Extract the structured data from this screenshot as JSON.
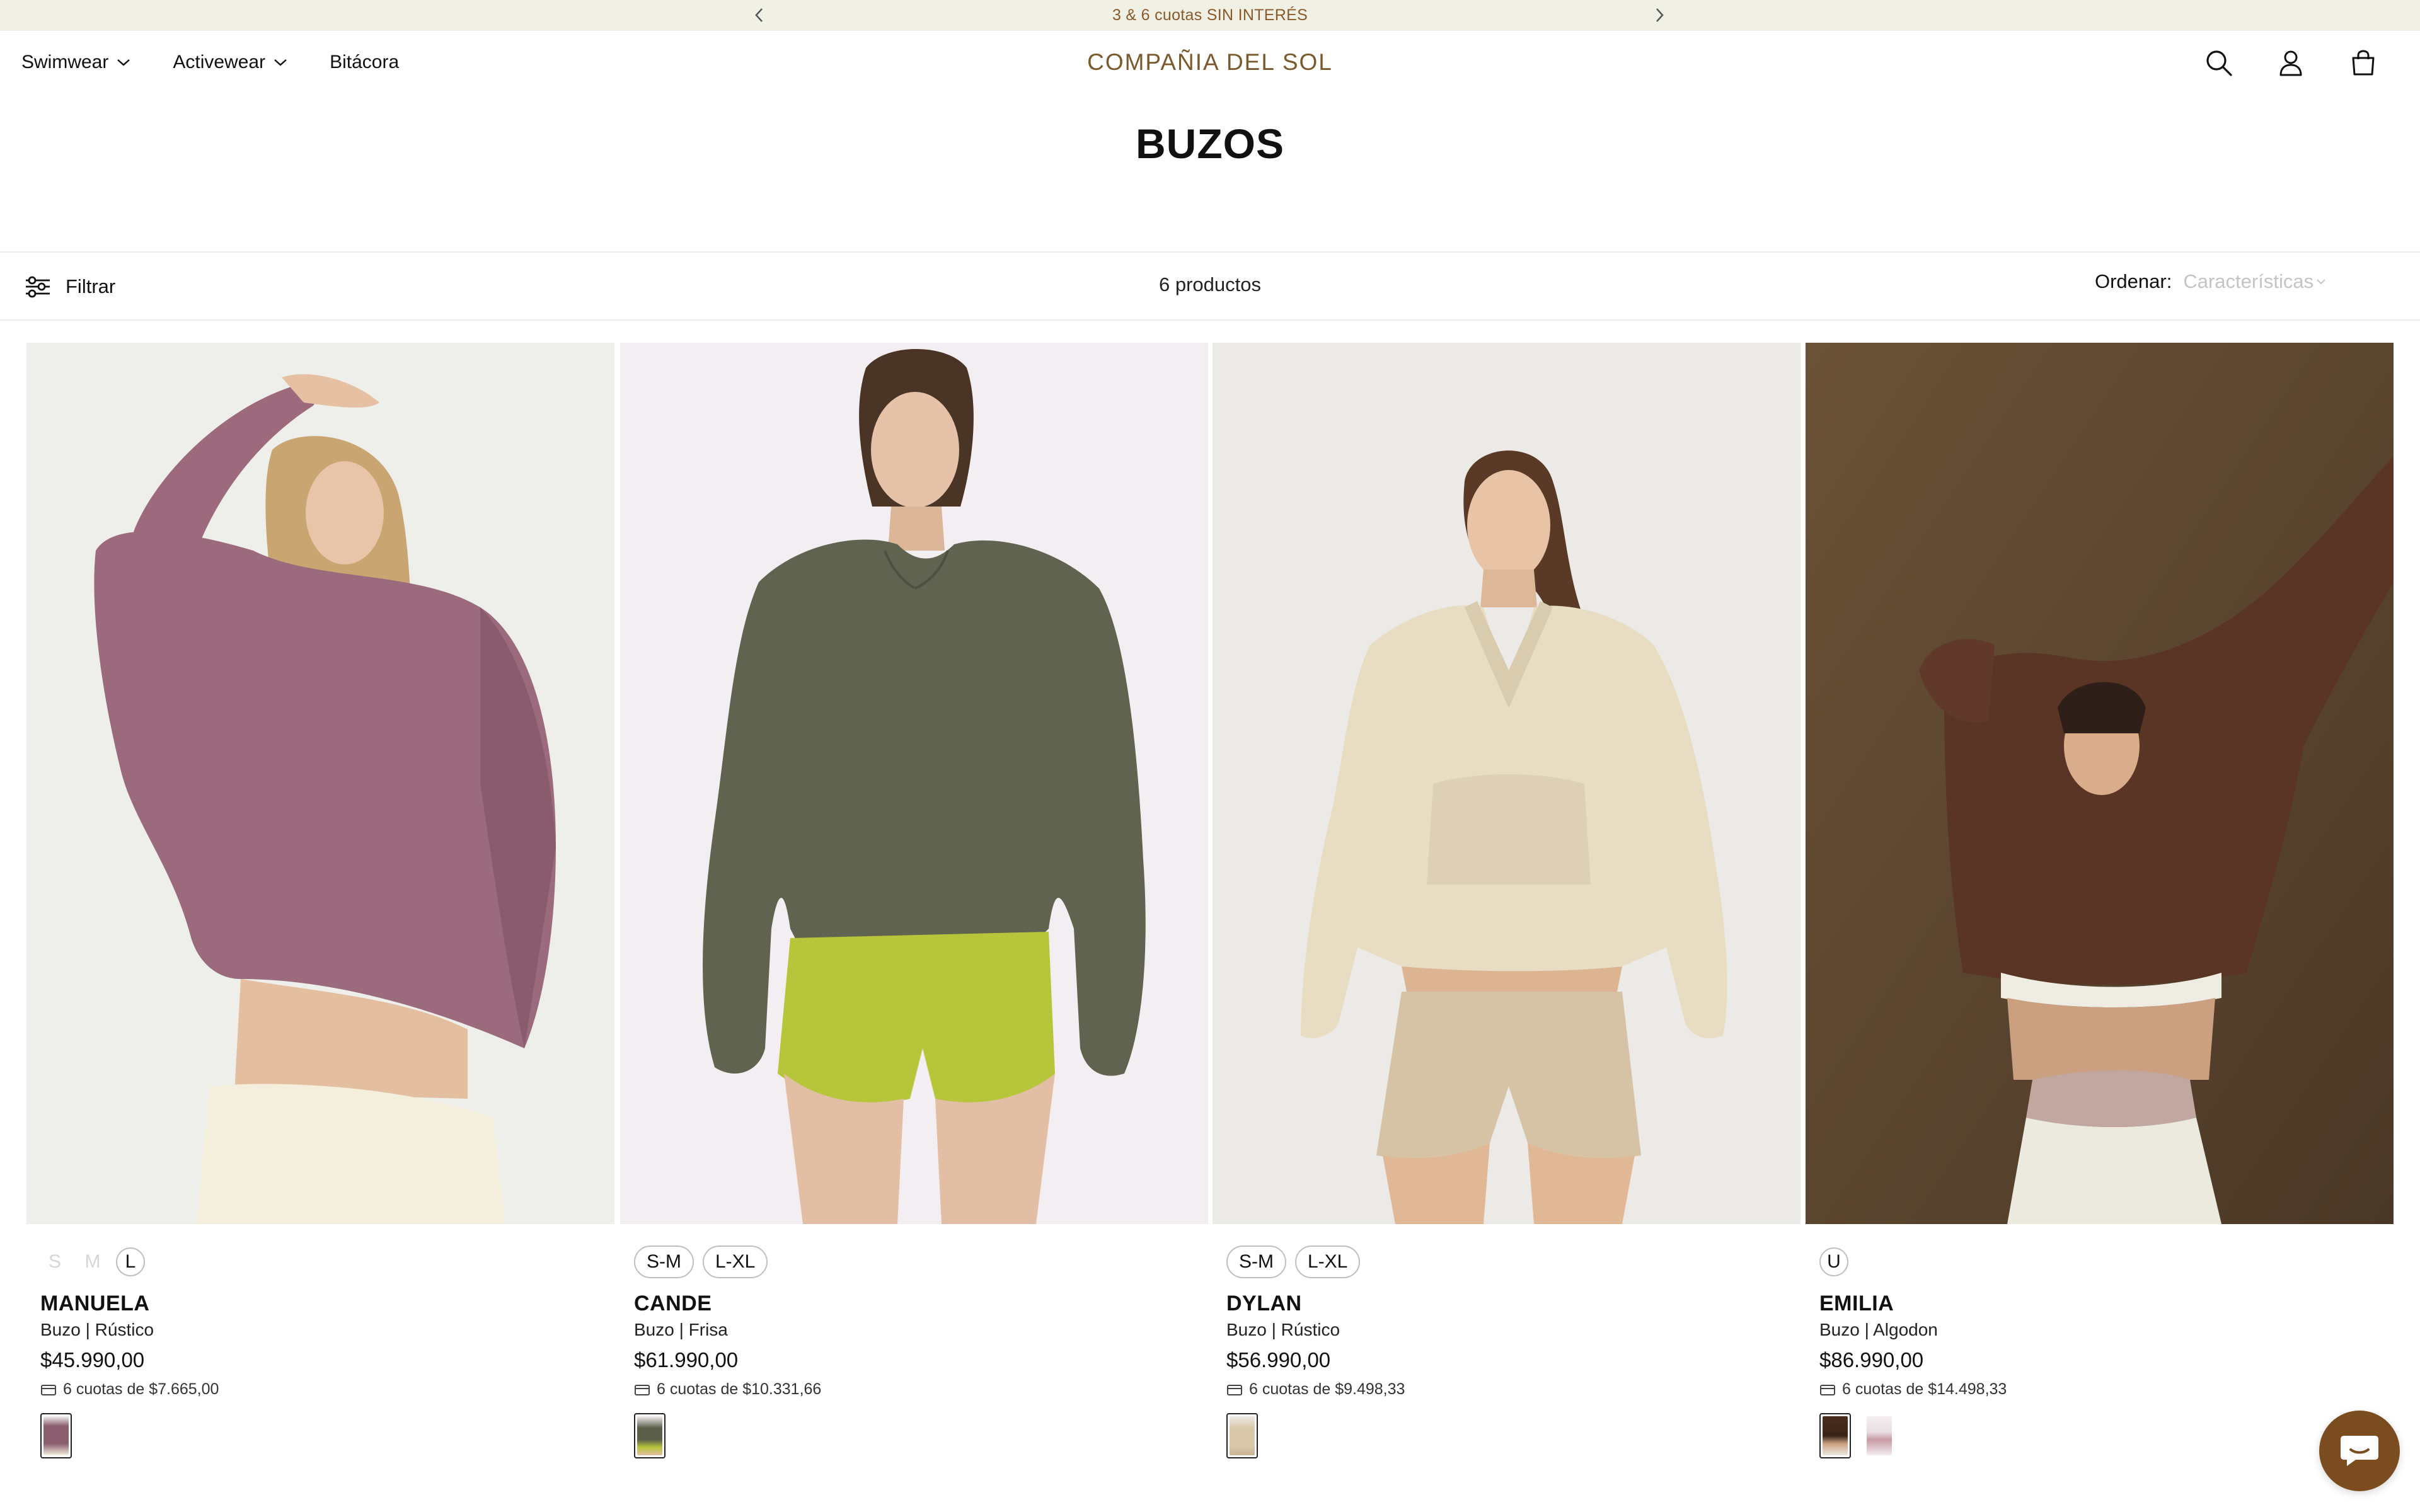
{
  "announcement": {
    "text": "3 & 6 cuotas SIN INTERÉS"
  },
  "nav": {
    "items": [
      {
        "label": "Swimwear"
      },
      {
        "label": "Activewear"
      },
      {
        "label": "Bitácora"
      }
    ]
  },
  "brand": {
    "name": "COMPAÑIA DEL SOL",
    "color": "#7a5a2c"
  },
  "page": {
    "title": "BUZOS"
  },
  "toolbar": {
    "filter_label": "Filtrar",
    "count": "6 productos",
    "sort_label": "Ordenar:",
    "sort_value": "Características"
  },
  "products": [
    {
      "sizes": [
        {
          "label": "S",
          "available": false
        },
        {
          "label": "M",
          "available": false
        },
        {
          "label": "L",
          "available": true
        }
      ],
      "name": "MANUELA",
      "subtitle": "Buzo | Rústico",
      "price": "$45.990,00",
      "cuotas": "6 cuotas de $7.665,00",
      "swatch_colors": [
        "#8a5d6f"
      ]
    },
    {
      "sizes": [
        {
          "label": "S-M",
          "available": true
        },
        {
          "label": "L-XL",
          "available": true
        }
      ],
      "name": "CANDE",
      "subtitle": "Buzo | Frisa",
      "price": "$61.990,00",
      "cuotas": "6 cuotas de $10.331,66",
      "swatch_colors": [
        "#5b5f4a"
      ]
    },
    {
      "sizes": [
        {
          "label": "S-M",
          "available": true
        },
        {
          "label": "L-XL",
          "available": true
        }
      ],
      "name": "DYLAN",
      "subtitle": "Buzo | Rústico",
      "price": "$56.990,00",
      "cuotas": "6 cuotas de $9.498,33",
      "swatch_colors": [
        "#d9c9aa"
      ]
    },
    {
      "sizes": [
        {
          "label": "U",
          "available": true
        }
      ],
      "name": "EMILIA",
      "subtitle": "Buzo | Algodon",
      "price": "$86.990,00",
      "cuotas": "6 cuotas de $14.498,33",
      "swatch_colors": [
        "#4a2c1c",
        "#e9dfe4"
      ]
    }
  ],
  "icons": {
    "search": "search-icon",
    "account": "user-icon",
    "cart": "bag-icon",
    "filter": "sliders-icon",
    "chat": "chat-icon",
    "card": "credit-card-icon"
  }
}
